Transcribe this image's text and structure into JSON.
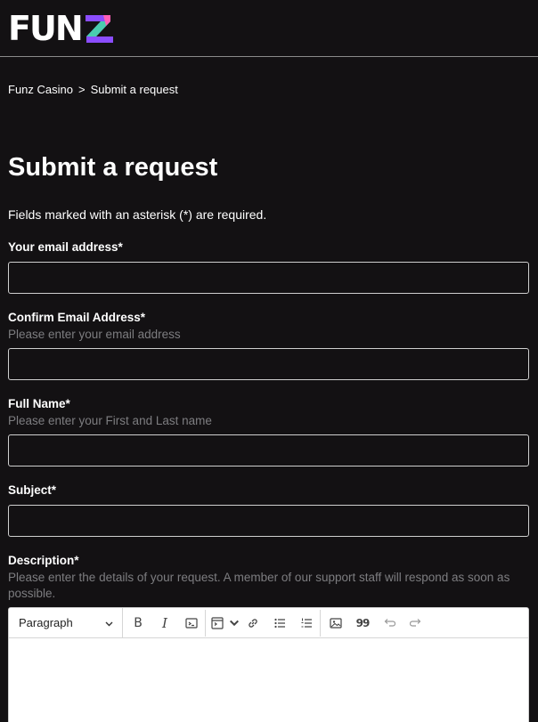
{
  "brand": {
    "logo_text_main": "FUN",
    "logo_text_accent": "Z"
  },
  "breadcrumb": {
    "home": "Funz Casino",
    "separator": ">",
    "current": "Submit a request"
  },
  "page": {
    "title": "Submit a request",
    "required_note": "Fields marked with an asterisk (*) are required."
  },
  "form": {
    "email": {
      "label": "Your email address*",
      "value": ""
    },
    "confirm_email": {
      "label": "Confirm Email Address*",
      "hint": "Please enter your email address",
      "value": ""
    },
    "full_name": {
      "label": "Full Name*",
      "hint": "Please enter your First and Last name",
      "value": ""
    },
    "subject": {
      "label": "Subject*",
      "value": ""
    },
    "description": {
      "label": "Description*",
      "hint": "Please enter the details of your request. A member of our support staff will respond as soon as possible.",
      "format": "Paragraph"
    }
  },
  "icons": {
    "bold": "B",
    "italic": "I",
    "quote": "99"
  },
  "colors": {
    "background": "#131113",
    "hint_text": "#7d7d80",
    "logo_z_purple": "#8b4dff",
    "logo_z_green": "#3ee3a0",
    "logo_z_pink": "#ff5fb7"
  }
}
